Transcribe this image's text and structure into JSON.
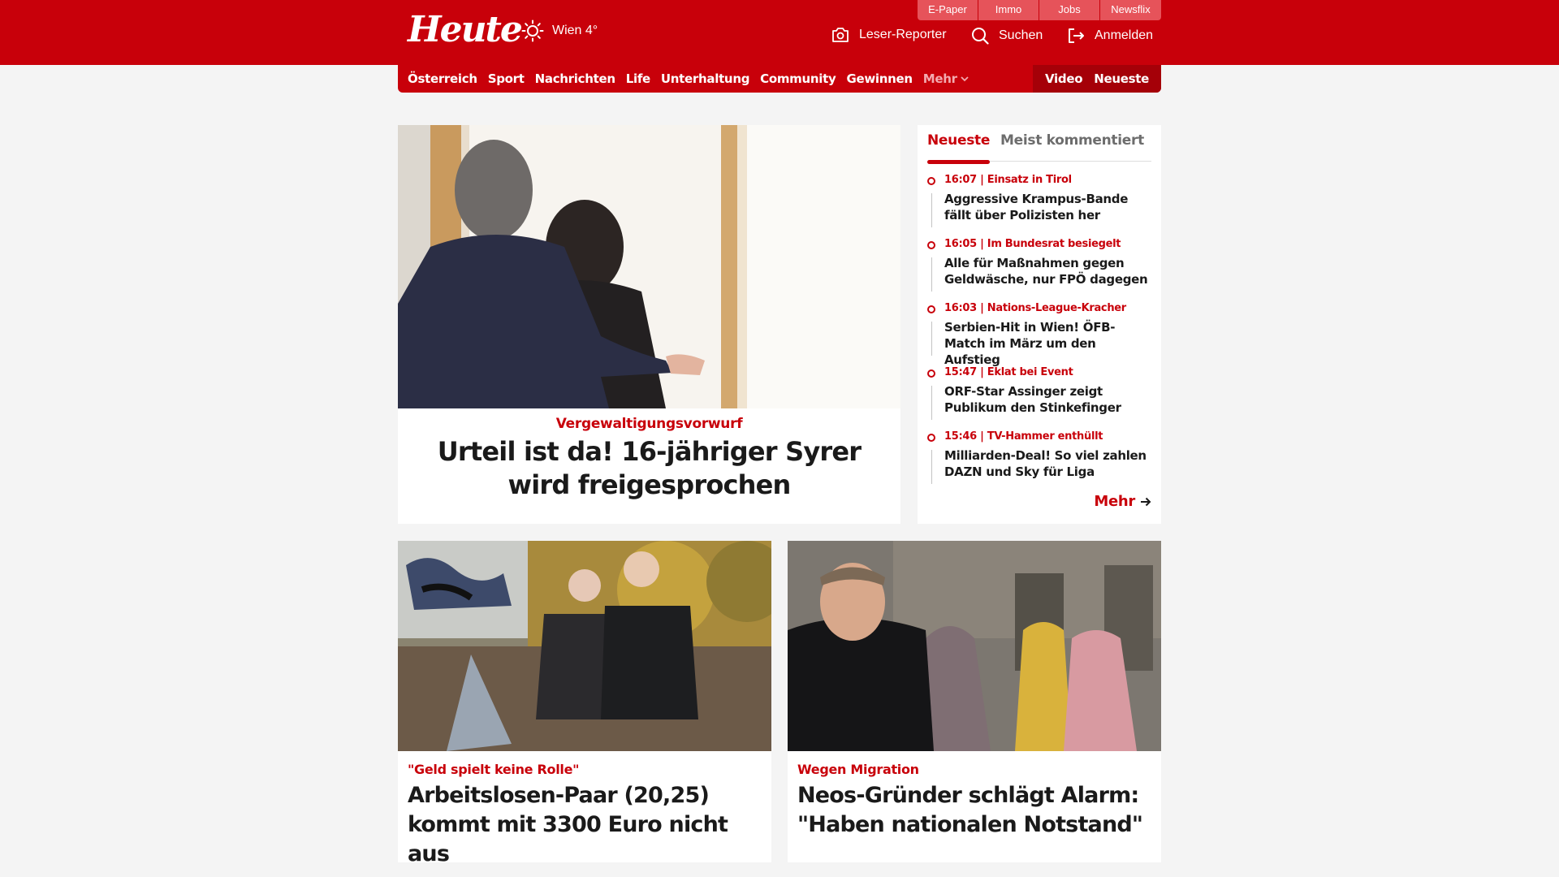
{
  "colors": {
    "brand_red": "#c8000a",
    "dark_red": "#a50008",
    "background": "#f4f4f4"
  },
  "header": {
    "logo": "Heute",
    "weather": {
      "icon": "sun-icon",
      "text": "Wien 4°"
    },
    "service_links": [
      "E-Paper",
      "Immo",
      "Jobs",
      "Newsflix"
    ],
    "actions": {
      "reporter": {
        "icon": "camera-icon",
        "label": "Leser-Reporter"
      },
      "search": {
        "icon": "search-icon",
        "label": "Suchen"
      },
      "login": {
        "icon": "login-icon",
        "label": "Anmelden"
      }
    }
  },
  "nav": {
    "items": [
      "Österreich",
      "Sport",
      "Nachrichten",
      "Life",
      "Unterhaltung",
      "Community",
      "Gewinnen"
    ],
    "more": "Mehr",
    "video": "Video",
    "latest": "Neueste"
  },
  "hero": {
    "image": "two-people-walking-photo",
    "kicker": "Vergewaltigungsvorwurf",
    "title": "Urteil ist da! 16-jähriger Syrer wird freigesprochen"
  },
  "sidebar": {
    "tabs": [
      "Neueste",
      "Meist kommentiert"
    ],
    "active_tab": "Neueste",
    "items": [
      {
        "meta": "16:07 | Einsatz in Tirol",
        "title": "Aggressive Krampus-Bande fällt über Polizisten her"
      },
      {
        "meta": "16:05 | Im Bundesrat besiegelt",
        "title": "Alle für Maßnahmen gegen Geldwäsche, nur FPÖ dagegen"
      },
      {
        "meta": "16:03 | Nations-League-Kracher",
        "title": "Serbien-Hit in Wien! ÖFB-Match im März um den Aufstieg"
      },
      {
        "meta": "15:47 | Eklat bei Event",
        "title": "ORF-Star Assinger zeigt Publikum den Stinkefinger"
      },
      {
        "meta": "15:46 | TV-Hammer enthüllt",
        "title": "Milliarden-Deal! So viel zahlen DAZN und Sky für Liga"
      }
    ],
    "more": "Mehr"
  },
  "cards": [
    {
      "image": "couple-with-stroller-photo",
      "kicker": "\"Geld spielt keine Rolle\"",
      "title": "Arbeitslosen-Paar (20,25) kommt mit 3300 Euro nicht aus"
    },
    {
      "image": "man-in-crowd-photo",
      "kicker": "Wegen Migration",
      "title": "Neos-Gründer schlägt Alarm: \"Haben nationalen Notstand\""
    }
  ]
}
